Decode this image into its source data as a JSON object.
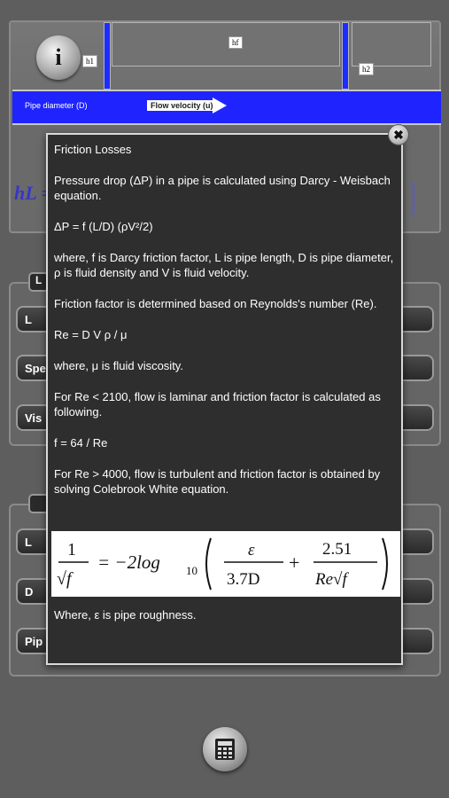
{
  "diagram": {
    "pipe_label": "Pipe diameter (D)",
    "flow_label": "Flow velocity (u)",
    "h1_label": "h1",
    "h2_label": "h2",
    "hf_label": "hf",
    "formula_fragment": "hL ="
  },
  "background_rows": {
    "section1_tab": "L",
    "row1": "L",
    "row2": "Spe",
    "row3": "Vis",
    "section2_tab": "",
    "row4": "L",
    "row5": "D",
    "row6": "Pip"
  },
  "dialog": {
    "title": "Friction Losses",
    "p1": "Pressure drop (ΔP) in a pipe is calculated using Darcy - Weisbach equation.",
    "eq1": "ΔP = f (L/D) (ρV²/2)",
    "p2": "where, f is Darcy friction factor, L is pipe length, D is pipe diameter, ρ is fluid density and V is fluid velocity.",
    "p3": "Friction factor is determined based on Reynolds's number (Re).",
    "eq2": "Re = D V ρ / μ",
    "p4": "where, μ is fluid viscosity.",
    "p5": "For Re < 2100, flow is laminar and friction factor is calculated as following.",
    "eq3": "f = 64 / Re",
    "p6": "For Re > 4000, flow is turbulent and friction factor is obtained by solving Colebrook White equation.",
    "colebrook": {
      "lhs_num": "1",
      "lhs_den": "√f",
      "coef": "= −2log",
      "sub": "10",
      "t1_num": "ε",
      "t1_den": "3.7D",
      "plus": "+",
      "t2_num": "2.51",
      "t2_den": "Re√f"
    },
    "p7": "Where, ε is pipe roughness."
  },
  "icons": {
    "info": "info-icon",
    "close": "close-icon",
    "calculator": "calculator-icon"
  },
  "colors": {
    "pipe_blue": "#1f24ff",
    "dialog_bg": "#2e2e2e",
    "app_bg": "#5e5e5e"
  }
}
